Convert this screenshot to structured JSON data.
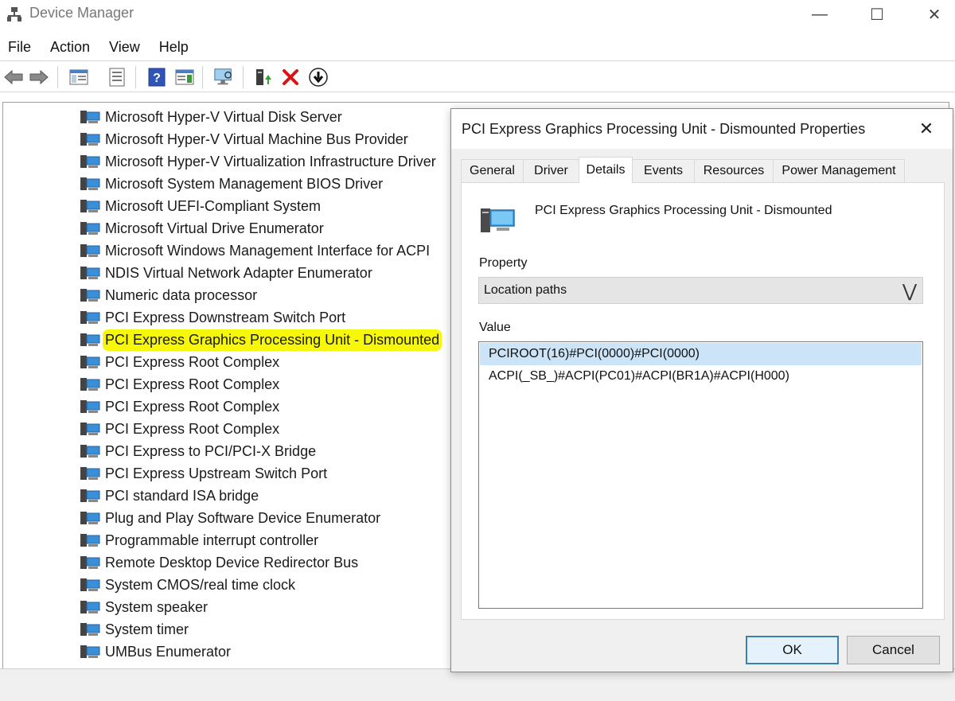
{
  "window": {
    "title": "Device Manager",
    "controls": {
      "minimize": "—",
      "maximize": "☐",
      "close": "✕"
    }
  },
  "menu": [
    "File",
    "Action",
    "View",
    "Help"
  ],
  "toolbar": {
    "icons": [
      "back-icon",
      "forward-icon",
      "show-hide-console-tree-icon",
      "properties-icon",
      "help-icon",
      "action-pane-icon",
      "scan-hardware-icon",
      "update-driver-icon",
      "uninstall-icon",
      "disable-device-icon"
    ]
  },
  "tree": {
    "items": [
      "Microsoft Hyper-V Virtual Disk Server",
      "Microsoft Hyper-V Virtual Machine Bus Provider",
      "Microsoft Hyper-V Virtualization Infrastructure Driver",
      "Microsoft System Management BIOS Driver",
      "Microsoft UEFI-Compliant System",
      "Microsoft Virtual Drive Enumerator",
      "Microsoft Windows Management Interface for ACPI",
      "NDIS Virtual Network Adapter Enumerator",
      "Numeric data processor",
      "PCI Express Downstream Switch Port",
      "PCI Express Graphics Processing Unit - Dismounted",
      "PCI Express Root Complex",
      "PCI Express Root Complex",
      "PCI Express Root Complex",
      "PCI Express Root Complex",
      "PCI Express to PCI/PCI-X Bridge",
      "PCI Express Upstream Switch Port",
      "PCI standard ISA bridge",
      "Plug and Play Software Device Enumerator",
      "Programmable interrupt controller",
      "Remote Desktop Device Redirector Bus",
      "System CMOS/real time clock",
      "System speaker",
      "System timer",
      "UMBus Enumerator"
    ],
    "highlight_color": "#f7f70a"
  },
  "dialog": {
    "title": "PCI Express Graphics Processing Unit - Dismounted Properties",
    "close": "✕",
    "tabs": [
      "General",
      "Driver",
      "Details",
      "Events",
      "Resources",
      "Power Management"
    ],
    "active_tab": "Details",
    "device_name": "PCI Express Graphics Processing Unit - Dismounted",
    "property_label": "Property",
    "property_value": "Location paths",
    "dropdown_arrow": "⋁",
    "value_label": "Value",
    "values": [
      "PCIROOT(16)#PCI(0000)#PCI(0000)",
      "ACPI(_SB_)#ACPI(PC01)#ACPI(BR1A)#ACPI(H000)"
    ],
    "ok_label": "OK",
    "cancel_label": "Cancel"
  }
}
